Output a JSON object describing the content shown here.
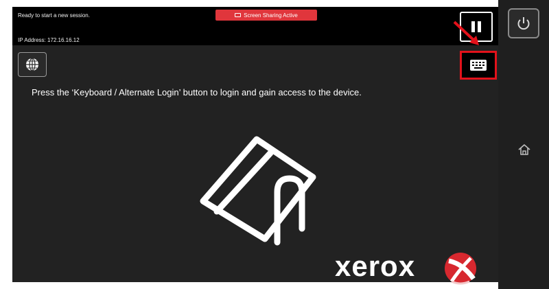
{
  "header": {
    "status_text": "Ready to start a new session.",
    "ip_text": "IP Address: 172.16.16.12",
    "screen_sharing_label": "Screen Sharing Active"
  },
  "main": {
    "instruction": "Press the ‘Keyboard / Alternate Login’ button to login and gain access to the device.",
    "brand": "xerox"
  },
  "icons": {
    "language": "globe-icon",
    "keyboard": "keyboard-icon",
    "pause": "pause-icon",
    "power": "power-icon",
    "home": "home-icon",
    "card": "card-tap-icon"
  },
  "colors": {
    "screen_bg": "#222222",
    "topbar_bg": "#000000",
    "sharing_badge": "#e0363c",
    "highlight": "#e3121b",
    "brand_red": "#d7282f"
  }
}
